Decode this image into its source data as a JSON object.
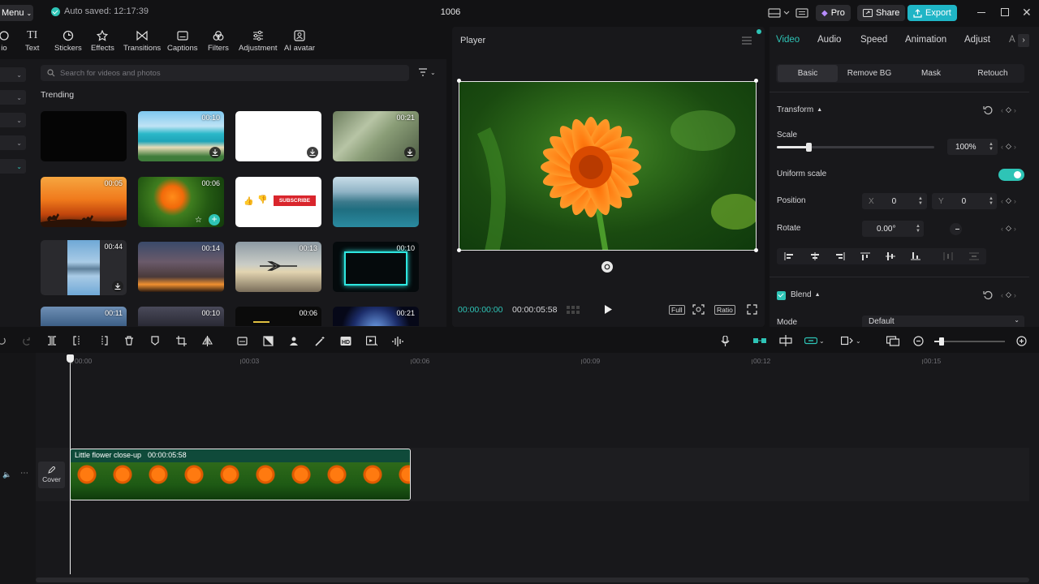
{
  "topbar": {
    "menu_label": "Menu",
    "autosave": "Auto saved: 12:17:39",
    "project_title": "1006",
    "pro_label": "Pro",
    "share_label": "Share",
    "export_label": "Export"
  },
  "toolbar": {
    "items": [
      {
        "label": "io"
      },
      {
        "label": "Text"
      },
      {
        "label": "Stickers"
      },
      {
        "label": "Effects"
      },
      {
        "label": "Transitions"
      },
      {
        "label": "Captions"
      },
      {
        "label": "Filters"
      },
      {
        "label": "Adjustment"
      },
      {
        "label": "AI avatar"
      }
    ]
  },
  "library": {
    "search_placeholder": "Search for videos and photos",
    "section_title": "Trending",
    "durations": [
      "00:10",
      "00:21",
      "00:05",
      "00:06",
      "00:44",
      "00:14",
      "00:13",
      "00:10",
      "00:11",
      "00:10",
      "00:06",
      "00:21"
    ],
    "subscribe_text": "SUBSCRIBE"
  },
  "player": {
    "title": "Player",
    "current_time": "00:00:00:00",
    "total_time": "00:00:05:58",
    "full_label": "Full",
    "ratio_label": "Ratio"
  },
  "properties": {
    "tabs": [
      "Video",
      "Audio",
      "Speed",
      "Animation",
      "Adjust",
      "A"
    ],
    "subtabs": [
      "Basic",
      "Remove BG",
      "Mask",
      "Retouch"
    ],
    "transform_label": "Transform",
    "scale_label": "Scale",
    "scale_value": "100%",
    "scale_fraction": 0.2,
    "uniform_scale_label": "Uniform scale",
    "position_label": "Position",
    "x_label": "X",
    "x_value": "0",
    "y_label": "Y",
    "y_value": "0",
    "rotate_label": "Rotate",
    "rotate_value": "0.00°",
    "blend_label": "Blend",
    "mode_label": "Mode",
    "mode_value": "Default"
  },
  "timeline": {
    "ticks": [
      "00:00",
      "00:03",
      "00:06",
      "00:09",
      "00:12",
      "00:15"
    ],
    "clip_name": "Little flower close-up",
    "clip_duration": "00:00:05:58",
    "cover_label": "Cover",
    "zoom_fraction": 0.1
  },
  "colors": {
    "accent": "#2ec4b6",
    "export_bg": "#1fb5c6",
    "pro_color": "#b78cff",
    "subscribe_red": "#d9252c"
  }
}
